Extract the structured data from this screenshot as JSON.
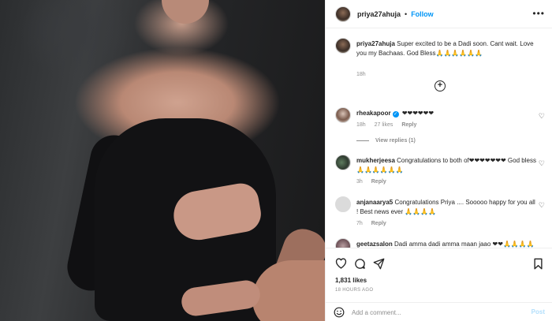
{
  "post": {
    "username": "priya27ahuja",
    "follow_label": "Follow",
    "dot": "•",
    "more": "•••"
  },
  "caption": {
    "username": "priya27ahuja",
    "text": "Super excited to be a Dadi soon. Cant wait. Love you my Bachaas. God Bless🙏🙏🙏🙏🙏🙏",
    "time": "18h"
  },
  "comments": [
    {
      "username": "rheakapoor",
      "verified": true,
      "text": "❤❤❤❤❤❤",
      "time": "18h",
      "likes": "27 likes",
      "reply": "Reply",
      "view_replies": "View replies (1)"
    },
    {
      "username": "mukherjeesa",
      "text": "Congratulations to both of❤❤❤❤❤❤❤ God bless 🙏🙏🙏🙏🙏🙏",
      "time": "3h",
      "reply": "Reply"
    },
    {
      "username": "anjanaarya5",
      "text": "Congratulations Priya .... Sooooo happy for you all ! Best news ever 🙏🙏🙏🙏",
      "time": "7h",
      "reply": "Reply"
    },
    {
      "username": "geetazsalon",
      "text": "Dadi amma dadi amma maan jaao ❤❤🙏🙏🙏🙏"
    }
  ],
  "actions": {
    "likes": "1,831 likes",
    "time_ago": "18 HOURS AGO",
    "comment_placeholder": "Add a comment...",
    "post_label": "Post"
  },
  "icons": [
    "heart-icon",
    "comment-icon",
    "share-icon",
    "bookmark-icon",
    "emoji-icon",
    "load-more-icon"
  ]
}
